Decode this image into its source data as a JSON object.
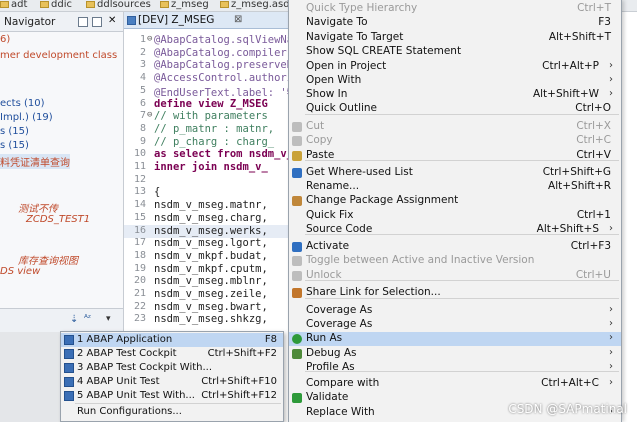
{
  "topbar": {
    "crumbs": [
      "adt",
      "ddic",
      "ddlsources",
      "z_mseg",
      "z_mseg.asdc"
    ]
  },
  "navigator": {
    "title": "Navigator",
    "lines": [
      {
        "text": "6)",
        "color": "#c04a2b"
      },
      {
        "text": "mer development class",
        "color": "#c04a2b"
      },
      {
        "text": "",
        "color": "#111"
      },
      {
        "text": "ects (10)",
        "color": "#1f4e9c"
      },
      {
        "text": "Impl.) (19)",
        "color": "#1f4e9c"
      },
      {
        "text": "s (15)",
        "color": "#1f4e9c"
      },
      {
        "text": "s (15)",
        "color": "#1f4e9c"
      },
      {
        "text": "料凭证清单查询",
        "color": "#c04a2b"
      },
      {
        "text": "",
        "color": "#111"
      },
      {
        "text": "测试不传",
        "color": "#c04a2b"
      },
      {
        "text": "ZCDS_TEST1",
        "color": "#c04a2b"
      },
      {
        "text": "",
        "color": "#111"
      },
      {
        "text": "库存查询视图",
        "color": "#c04a2b"
      },
      {
        "text": "DS   view",
        "color": "#c04a2b"
      }
    ]
  },
  "editor": {
    "tab_label": "[DEV] Z_MSEG",
    "lines": [
      {
        "n": "1",
        "code": "@AbapCatalog.sqlViewName",
        "cls": "c-ann"
      },
      {
        "n": "2",
        "code": "@AbapCatalog.compiler.co",
        "cls": "c-ann"
      },
      {
        "n": "3",
        "code": "@AbapCatalog.preserveKey",
        "cls": "c-ann"
      },
      {
        "n": "4",
        "code": "@AccessControl.authoriza",
        "cls": "c-ann"
      },
      {
        "n": "5",
        "code": "@EndUserText.label: '物料",
        "cls": "c-ann"
      },
      {
        "n": "6",
        "code": "define view Z_MSEG",
        "cls": "c-kw"
      },
      {
        "n": "7",
        "code": "  //  with parameters",
        "cls": "c-cm"
      },
      {
        "n": "8",
        "code": "  //    p_matnr : matnr,",
        "cls": "c-cm"
      },
      {
        "n": "9",
        "code": "  //    p_charg : charg_",
        "cls": "c-cm"
      },
      {
        "n": "10",
        "code": "  as select from nsdm_v_",
        "cls": "c-kw"
      },
      {
        "n": "11",
        "code": "    inner join   nsdm_v_",
        "cls": "c-kw"
      },
      {
        "n": "12",
        "code": "",
        "cls": "c-tx"
      },
      {
        "n": "13",
        "code": "{",
        "cls": "c-tx"
      },
      {
        "n": "14",
        "code": "  nsdm_v_mseg.matnr,",
        "cls": "c-tx"
      },
      {
        "n": "15",
        "code": "  nsdm_v_mseg.charg,",
        "cls": "c-tx"
      },
      {
        "n": "16",
        "code": "  nsdm_v_mseg.werks,",
        "cls": "c-tx"
      },
      {
        "n": "17",
        "code": "  nsdm_v_mseg.lgort,",
        "cls": "c-tx"
      },
      {
        "n": "18",
        "code": "  nsdm_v_mkpf.budat,",
        "cls": "c-tx"
      },
      {
        "n": "19",
        "code": "  nsdm_v_mkpf.cputm,",
        "cls": "c-tx"
      },
      {
        "n": "20",
        "code": "  nsdm_v_mseg.mblnr,",
        "cls": "c-tx"
      },
      {
        "n": "21",
        "code": "  nsdm_v_mseg.zeile,",
        "cls": "c-tx"
      },
      {
        "n": "22",
        "code": "  nsdm_v_mseg.bwart,",
        "cls": "c-tx"
      },
      {
        "n": "23",
        "code": "  nsdm_v_mseg.shkzg,",
        "cls": "c-tx"
      }
    ]
  },
  "submenu": {
    "items": [
      {
        "label": "1 ABAP Application",
        "shortcut": "F8"
      },
      {
        "label": "2 ABAP Test Cockpit",
        "shortcut": "Ctrl+Shift+F2"
      },
      {
        "label": "3 ABAP Test Cockpit With...",
        "shortcut": ""
      },
      {
        "label": "4 ABAP Unit Test",
        "shortcut": "Ctrl+Shift+F10"
      },
      {
        "label": "5 ABAP Unit Test With...",
        "shortcut": "Ctrl+Shift+F12"
      },
      {
        "label": "Run Configurations...",
        "shortcut": ""
      }
    ]
  },
  "context_menu": {
    "items": [
      {
        "label": "Quick Type Hierarchy",
        "shortcut": "Ctrl+T",
        "disabled": true
      },
      {
        "label": "Navigate To",
        "shortcut": "F3"
      },
      {
        "label": "Navigate To Target",
        "shortcut": "Alt+Shift+T"
      },
      {
        "label": "Show SQL CREATE Statement",
        "shortcut": ""
      },
      {
        "label": "Open in Project",
        "shortcut": "Ctrl+Alt+P",
        "arrow": true
      },
      {
        "label": "Open With",
        "shortcut": "",
        "arrow": true
      },
      {
        "label": "Show In",
        "shortcut": "Alt+Shift+W",
        "arrow": true
      },
      {
        "label": "Quick Outline",
        "shortcut": "Ctrl+O"
      },
      {
        "label": "Cut",
        "shortcut": "Ctrl+X",
        "disabled": true
      },
      {
        "label": "Copy",
        "shortcut": "Ctrl+C",
        "disabled": true
      },
      {
        "label": "Paste",
        "shortcut": "Ctrl+V"
      },
      {
        "label": "Get Where-used List",
        "shortcut": "Ctrl+Shift+G"
      },
      {
        "label": "Rename...",
        "shortcut": "Alt+Shift+R"
      },
      {
        "label": "Change Package Assignment",
        "shortcut": ""
      },
      {
        "label": "Quick Fix",
        "shortcut": "Ctrl+1"
      },
      {
        "label": "Source Code",
        "shortcut": "Alt+Shift+S",
        "arrow": true
      },
      {
        "label": "Activate",
        "shortcut": "Ctrl+F3"
      },
      {
        "label": "Toggle between Active and Inactive Version",
        "shortcut": "",
        "disabled": true
      },
      {
        "label": "Unlock",
        "shortcut": "Ctrl+U",
        "disabled": true
      },
      {
        "label": "Share Link for Selection...",
        "shortcut": ""
      },
      {
        "label": "Coverage As",
        "shortcut": "",
        "arrow": true
      },
      {
        "label": "Coverage As",
        "shortcut": "",
        "arrow": true
      },
      {
        "label": "Run As",
        "shortcut": "",
        "arrow": true,
        "highlight": true
      },
      {
        "label": "Debug As",
        "shortcut": "",
        "arrow": true
      },
      {
        "label": "Profile As",
        "shortcut": "",
        "arrow": true
      },
      {
        "label": "Compare with",
        "shortcut": "Ctrl+Alt+C",
        "arrow": true
      },
      {
        "label": "Validate",
        "shortcut": ""
      },
      {
        "label": "Replace With",
        "shortcut": "",
        "arrow": true
      }
    ]
  },
  "watermark": "CSDN @SAPmatinal",
  "colors": {
    "accent": "#bfd6f2",
    "menu_bg": "#f2f2f2",
    "disabled": "#9a9a9a"
  }
}
